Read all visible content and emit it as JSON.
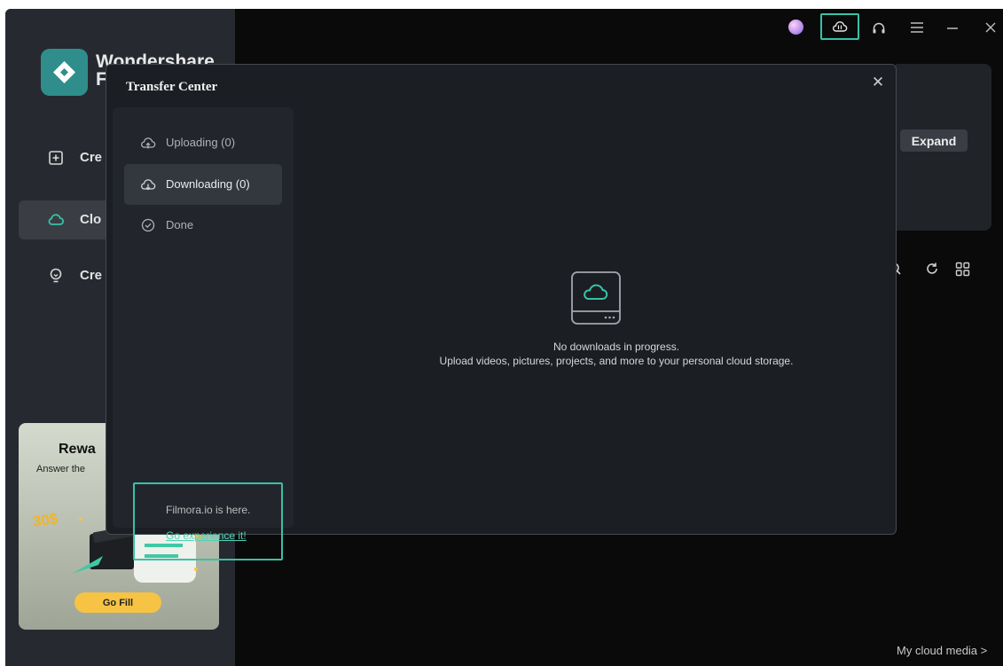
{
  "app": {
    "brand_line1": "Wondershare",
    "brand_line2": "F",
    "accent_color": "#37c2a7"
  },
  "sidebar": {
    "items": [
      {
        "icon": "plus-square-icon",
        "label": "Cre"
      },
      {
        "icon": "cloud-icon",
        "label": "Clo"
      },
      {
        "icon": "lightbulb-icon",
        "label": "Cre"
      }
    ]
  },
  "rewards": {
    "title": "Rewa",
    "subtitle": "Answer the",
    "amount": "30$",
    "button": "Go Fill"
  },
  "main": {
    "expand_label": "Expand",
    "cloud_media_link": "My cloud media >"
  },
  "topbar": {
    "icons": [
      "avatar",
      "cloud-transfer-icon",
      "headset-icon",
      "menu-icon",
      "minimize-icon",
      "close-icon"
    ]
  },
  "modal": {
    "title": "Transfer Center",
    "close_glyph": "✕",
    "tabs": [
      {
        "icon": "cloud-upload-icon",
        "label": "Uploading (0)",
        "active": false
      },
      {
        "icon": "cloud-download-icon",
        "label": "Downloading (0)",
        "active": true
      },
      {
        "icon": "check-circle-icon",
        "label": "Done",
        "active": false
      }
    ],
    "promo": {
      "text": "Filmora.io is here.",
      "link": "Go experience it!"
    },
    "empty": {
      "line1": "No downloads in progress.",
      "line2": "Upload videos, pictures, projects, and more to your personal cloud storage."
    }
  }
}
